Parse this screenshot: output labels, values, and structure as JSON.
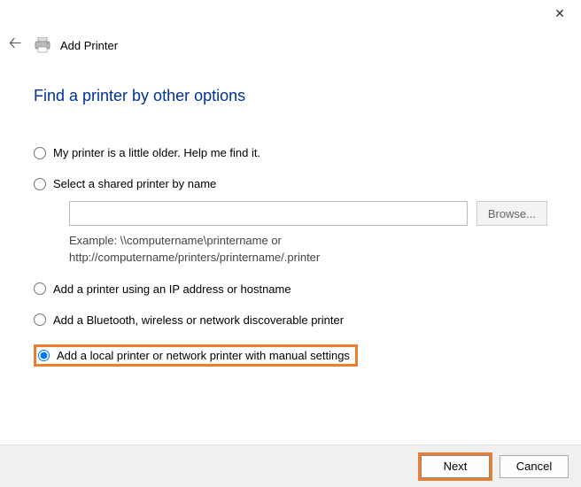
{
  "header": {
    "title": "Add Printer"
  },
  "page": {
    "heading": "Find a printer by other options"
  },
  "options": {
    "older": "My printer is a little older. Help me find it.",
    "shared": "Select a shared printer by name",
    "shared_input_value": "",
    "browse_label": "Browse...",
    "example_line1": "Example: \\\\computername\\printername or",
    "example_line2": "http://computername/printers/printername/.printer",
    "ip": "Add a printer using an IP address or hostname",
    "bluetooth": "Add a Bluetooth, wireless or network discoverable printer",
    "local": "Add a local printer or network printer with manual settings"
  },
  "footer": {
    "next": "Next",
    "cancel": "Cancel"
  },
  "colors": {
    "highlight": "#ed7d31",
    "heading": "#003399"
  }
}
